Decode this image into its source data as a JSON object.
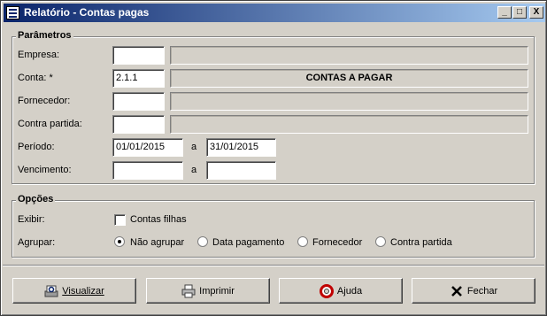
{
  "window": {
    "title": "Relatório - Contas pagas",
    "controls": {
      "minimize": "_",
      "maximize": "□",
      "close": "X"
    }
  },
  "parametros": {
    "title": "Parâmetros",
    "empresa": {
      "label": "Empresa:",
      "code": "",
      "description": ""
    },
    "conta": {
      "label": "Conta: *",
      "code": "2.1.1",
      "description": "CONTAS A PAGAR"
    },
    "fornecedor": {
      "label": "Fornecedor:",
      "code": "",
      "description": ""
    },
    "contra_partida": {
      "label": "Contra partida:",
      "code": "",
      "description": ""
    },
    "periodo": {
      "label": "Período:",
      "from": "01/01/2015",
      "sep": "a",
      "to": "31/01/2015"
    },
    "vencimento": {
      "label": "Vencimento:",
      "from": "",
      "sep": "a",
      "to": ""
    }
  },
  "opcoes": {
    "title": "Opções",
    "exibir": {
      "label": "Exibir:",
      "checkbox_label": "Contas filhas",
      "checked": false
    },
    "agrupar": {
      "label": "Agrupar:",
      "options": [
        {
          "label": "Não agrupar",
          "selected": true
        },
        {
          "label": "Data pagamento",
          "selected": false
        },
        {
          "label": "Fornecedor",
          "selected": false
        },
        {
          "label": "Contra partida",
          "selected": false
        }
      ]
    }
  },
  "buttons": {
    "visualizar": {
      "label": "Visualizar",
      "icon": "preview-icon"
    },
    "imprimir": {
      "label": "Imprimir",
      "icon": "printer-icon"
    },
    "ajuda": {
      "label": "Ajuda",
      "icon": "lifebuoy-icon"
    },
    "fechar": {
      "label": "Fechar",
      "icon": "close-x-icon"
    }
  }
}
